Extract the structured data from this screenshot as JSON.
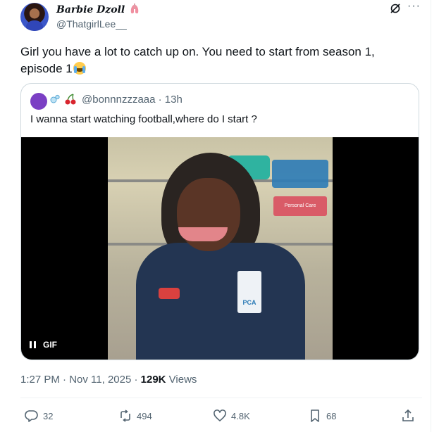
{
  "post": {
    "author_name": "Barbie Dzoll",
    "author_emoji": "lungs-emoji",
    "author_handle": "@ThatgirlLee__",
    "text": "Girl you have a lot to catch up on. You need to start from season 1, episode 1",
    "text_emoji": "crying-face-emoji",
    "timestamp": "1:27 PM · Nov 11, 2025 · ",
    "views_count": "129K",
    "views_label": " Views"
  },
  "quote": {
    "handle": "@bonnnzzzaaa · 13h",
    "text": "I wanna start watching football,where do I start ?",
    "media_sign": "Personal Care",
    "media_badge": "PCA",
    "gif_label": "GIF"
  },
  "actions": {
    "replies": "32",
    "reposts": "494",
    "likes": "4.8K",
    "bookmarks": "68"
  },
  "colors": {
    "text": "#0f1419",
    "secondary": "#536471",
    "border": "#cfd9de"
  }
}
